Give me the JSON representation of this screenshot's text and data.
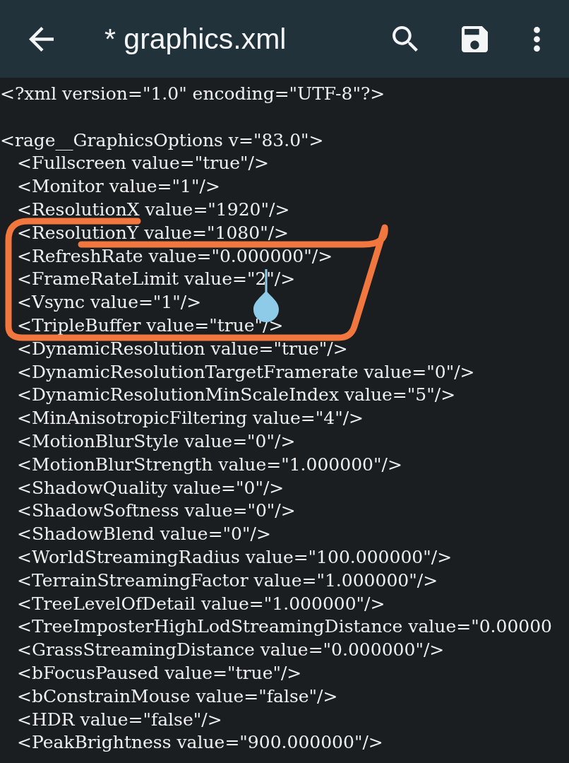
{
  "app_bar": {
    "title": "* graphics.xml"
  },
  "editor": {
    "lines": [
      {
        "kind": "code",
        "text": "<?xml version=\"1.0\" encoding=\"UTF-8\"?>"
      },
      {
        "kind": "blank"
      },
      {
        "kind": "code",
        "text": "<rage__GraphicsOptions v=\"83.0\">",
        "children": [
          {
            "kind": "code",
            "text": "<Fullscreen value=\"true\"/>"
          },
          {
            "kind": "code",
            "text": "<Monitor value=\"1\"/>"
          },
          {
            "kind": "code",
            "text": "<ResolutionX value=\"1920\"/>"
          },
          {
            "kind": "code",
            "text": "<ResolutionY value=\"1080\"/>"
          },
          {
            "kind": "code",
            "text": "<RefreshRate value=\"0.000000\"/>"
          },
          {
            "kind": "code",
            "text_before_cursor": "<FrameRateLimit value=\"2",
            "text_after_cursor": "\"/>"
          },
          {
            "kind": "code",
            "text": "<Vsync value=\"1\"/>"
          },
          {
            "kind": "code",
            "text": "<TripleBuffer value=\"true\"/>"
          },
          {
            "kind": "code",
            "text": "<DynamicResolution value=\"true\"/>"
          },
          {
            "kind": "code",
            "text": "<DynamicResolutionTargetFramerate value=\"0\"/>"
          },
          {
            "kind": "code",
            "text": "<DynamicResolutionMinScaleIndex value=\"5\"/>"
          },
          {
            "kind": "code",
            "text": "<MinAnisotropicFiltering value=\"4\"/>"
          },
          {
            "kind": "code",
            "text": "<MotionBlurStyle value=\"0\"/>"
          },
          {
            "kind": "code",
            "text": "<MotionBlurStrength value=\"1.000000\"/>"
          },
          {
            "kind": "code",
            "text": "<ShadowQuality value=\"0\"/>"
          },
          {
            "kind": "code",
            "text": "<ShadowSoftness value=\"0\"/>"
          },
          {
            "kind": "code",
            "text": "<ShadowBlend value=\"0\"/>"
          },
          {
            "kind": "code",
            "text": "<WorldStreamingRadius value=\"100.000000\"/>"
          },
          {
            "kind": "code",
            "text": "<TerrainStreamingFactor value=\"1.000000\"/>"
          },
          {
            "kind": "code",
            "text": "<TreeLevelOfDetail value=\"1.000000\"/>"
          },
          {
            "kind": "code",
            "text": "<TreeImposterHighLodStreamingDistance value=\"0.00000"
          },
          {
            "kind": "code",
            "text": "<GrassStreamingDistance value=\"0.000000\"/>"
          },
          {
            "kind": "code",
            "text": "<bFocusPaused value=\"true\"/>"
          },
          {
            "kind": "code",
            "text": "<bConstrainMouse value=\"false\"/>"
          },
          {
            "kind": "code",
            "text": "<HDR value=\"false\"/>"
          },
          {
            "kind": "code",
            "text": "<PeakBrightness value=\"900.000000\"/>"
          }
        ]
      }
    ]
  },
  "annotation": {
    "kind": "loop"
  }
}
